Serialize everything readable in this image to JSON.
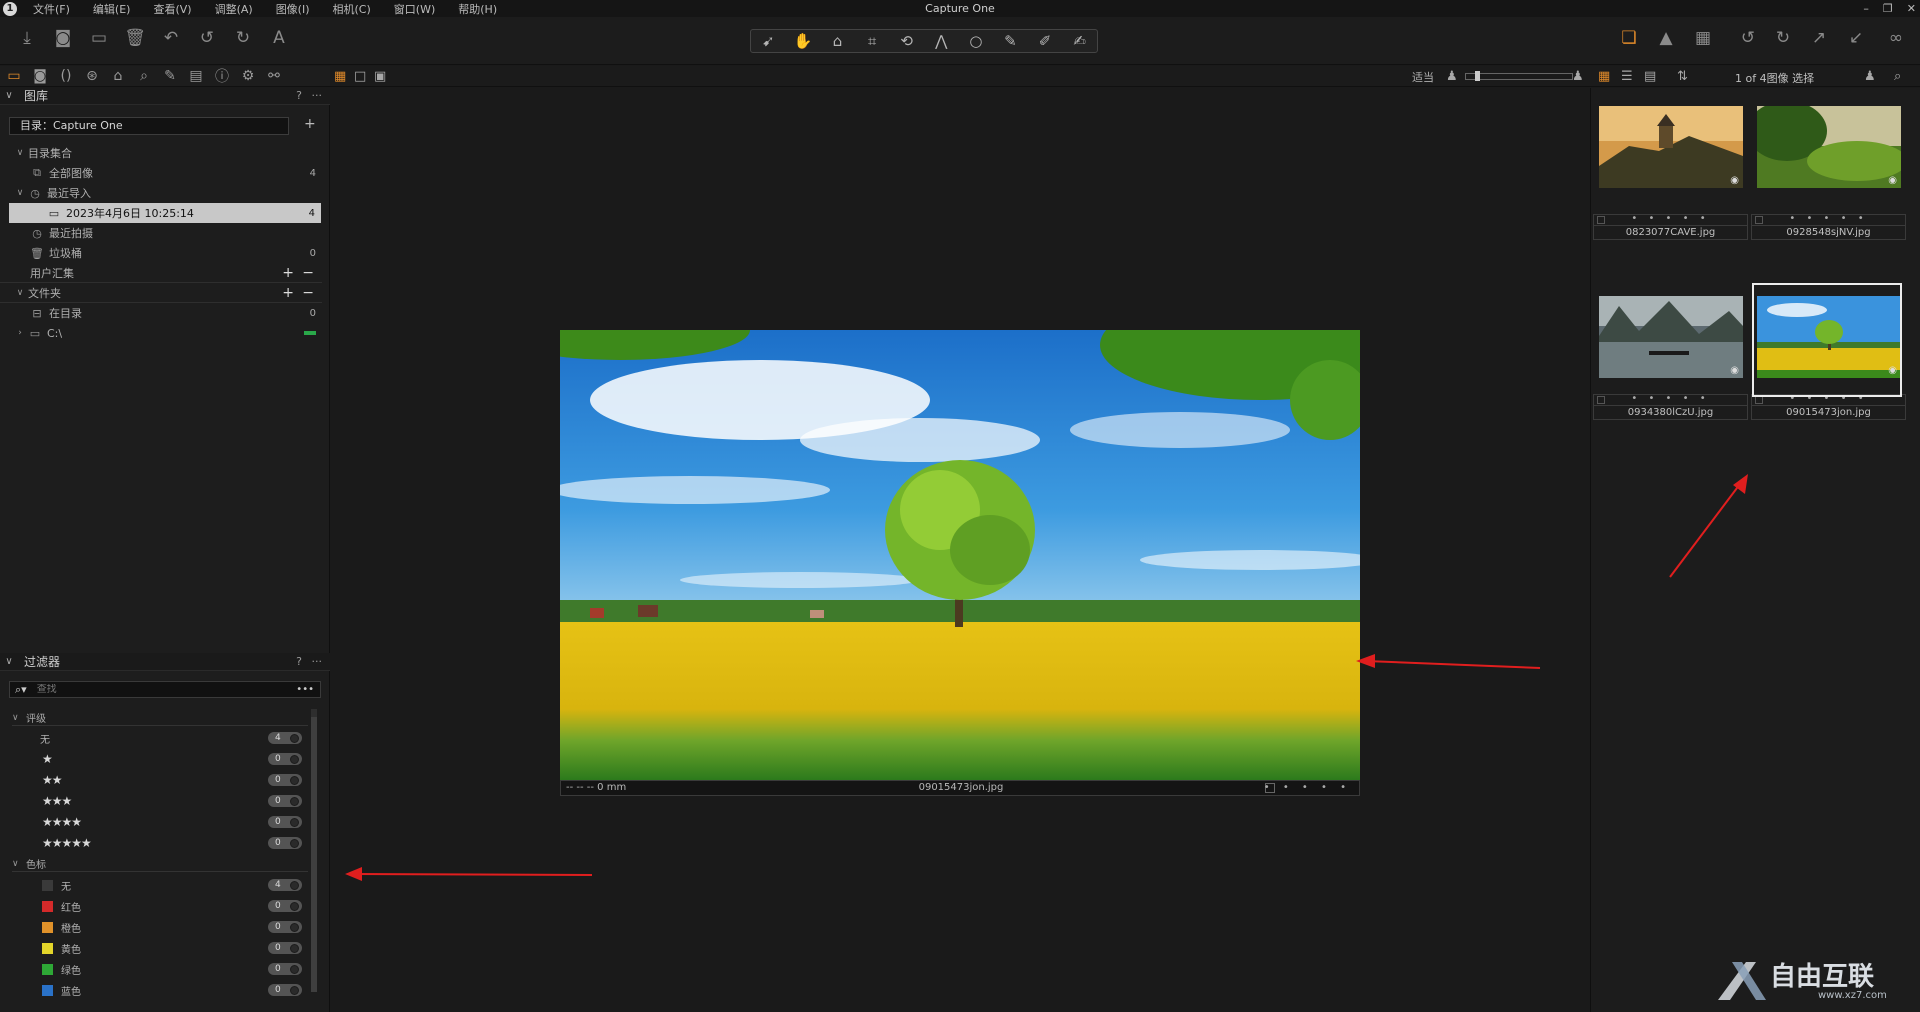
{
  "app": {
    "title": "Capture One",
    "logo_letter": "1"
  },
  "menu": [
    "文件(F)",
    "编辑(E)",
    "查看(V)",
    "调整(A)",
    "图像(I)",
    "相机(C)",
    "窗口(W)",
    "帮助(H)"
  ],
  "viewer_header": {
    "zoom_label": "适当"
  },
  "browser_header": {
    "count_label": "1 of 4图像 选择"
  },
  "library": {
    "title": "图库",
    "help": "?",
    "more": "···",
    "catalog_select": "目录：Capture One",
    "catalog_collections_label": "目录集合",
    "all_images": {
      "label": "全部图像",
      "count": "4"
    },
    "recent_imports": {
      "label": "最近导入"
    },
    "import_entry": {
      "label": "2023年4月6日 10:25:14",
      "count": "4"
    },
    "recent_captures": {
      "label": "最近拍摄"
    },
    "trash": {
      "label": "垃圾桶",
      "count": "0"
    },
    "user_collections": {
      "label": "用户汇集"
    },
    "folders": {
      "label": "文件夹"
    },
    "in_catalog": {
      "label": "在目录",
      "count": "0"
    },
    "drive_c": {
      "label": "C:\\"
    }
  },
  "filters": {
    "title": "过滤器",
    "help": "?",
    "more": "···",
    "search_placeholder": "查找",
    "rating_group": "评级",
    "rating_rows": [
      {
        "label": "无",
        "count": "4"
      },
      {
        "stars": "★",
        "count": "0"
      },
      {
        "stars": "★★",
        "count": "0"
      },
      {
        "stars": "★★★",
        "count": "0"
      },
      {
        "stars": "★★★★",
        "count": "0"
      },
      {
        "stars": "★★★★★",
        "count": "0"
      }
    ],
    "color_group": "色标",
    "color_rows": [
      {
        "label": "无",
        "count": "4",
        "color": "#3a3a3a"
      },
      {
        "label": "红色",
        "count": "0",
        "color": "#d42a2a"
      },
      {
        "label": "橙色",
        "count": "0",
        "color": "#e0922a"
      },
      {
        "label": "黄色",
        "count": "0",
        "color": "#e3d52a"
      },
      {
        "label": "绿色",
        "count": "0",
        "color": "#2ea836"
      },
      {
        "label": "蓝色",
        "count": "0",
        "color": "#2a72c8"
      }
    ]
  },
  "viewer": {
    "caption_lens": "-- -- -- 0 mm",
    "caption_name": "09015473jon.jpg",
    "caption_rating": "• • • • •"
  },
  "browser": {
    "thumbnails": [
      {
        "name": "0823077CAVE.jpg",
        "rating": "• • • • •"
      },
      {
        "name": "0928548sjNV.jpg",
        "rating": "• • • • •"
      },
      {
        "name": "0934380lCzU.jpg",
        "rating": "• • • • •"
      },
      {
        "name": "09015473jon.jpg",
        "rating": "• • • • •",
        "selected": true
      }
    ]
  },
  "watermark": {
    "text": "自由互联",
    "url": "www.xz7.com"
  },
  "colors": {
    "accent": "#e08a2a",
    "annotation_arrow": "#e01e1e",
    "selection": "#c8c8c8"
  }
}
